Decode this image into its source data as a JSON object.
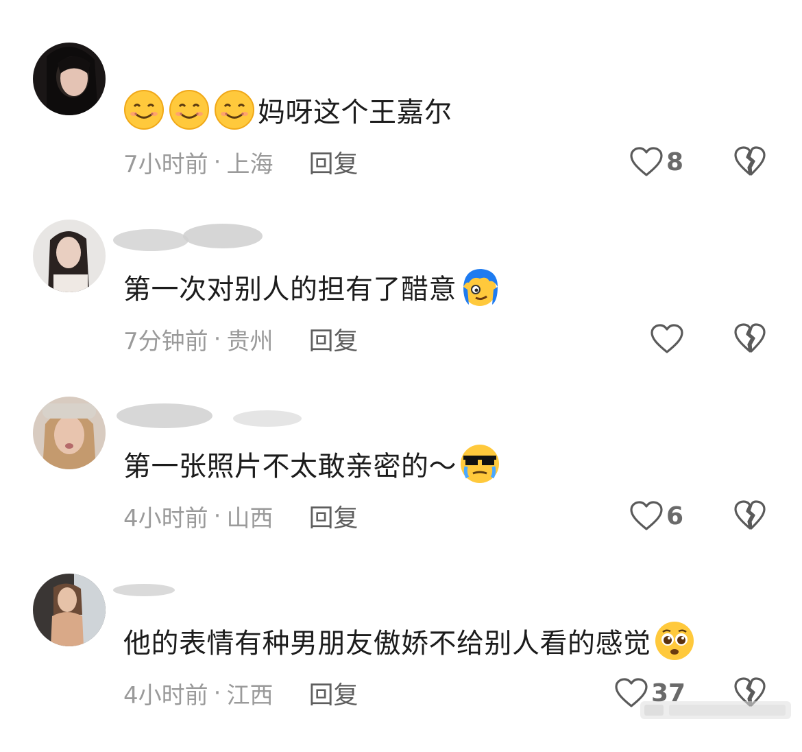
{
  "comments": [
    {
      "text": "妈呀这个王嘉尔",
      "time": "7小时前",
      "dot": "·",
      "location": "上海",
      "reply_label": "回复",
      "like_count": "8",
      "lead_emojis": [
        "smile-emoji",
        "smile-emoji",
        "smile-emoji"
      ],
      "trail_emoji": ""
    },
    {
      "text": "第一次对别人的担有了醋意",
      "time": "7分钟前",
      "dot": "·",
      "location": "贵州",
      "reply_label": "回复",
      "like_count": "",
      "trail_emoji": "blue-hair-emoji"
    },
    {
      "text": "第一张照片不太敢亲密的～",
      "time": "4小时前",
      "dot": "·",
      "location": "山西",
      "reply_label": "回复",
      "like_count": "6",
      "trail_emoji": "sunglasses-tears-emoji"
    },
    {
      "text": "他的表情有种男朋友傲娇不给别人看的感觉",
      "time": "4小时前",
      "dot": "·",
      "location": "江西",
      "reply_label": "回复",
      "like_count": "37",
      "trail_emoji": "pleading-emoji"
    }
  ],
  "icons": {
    "like": "heart-outline-icon",
    "dislike": "broken-heart-icon"
  },
  "colors": {
    "text": "#1c1c1c",
    "meta": "#9a9a9a",
    "reply": "#5e5e5e",
    "icon": "#5a5a5a"
  }
}
